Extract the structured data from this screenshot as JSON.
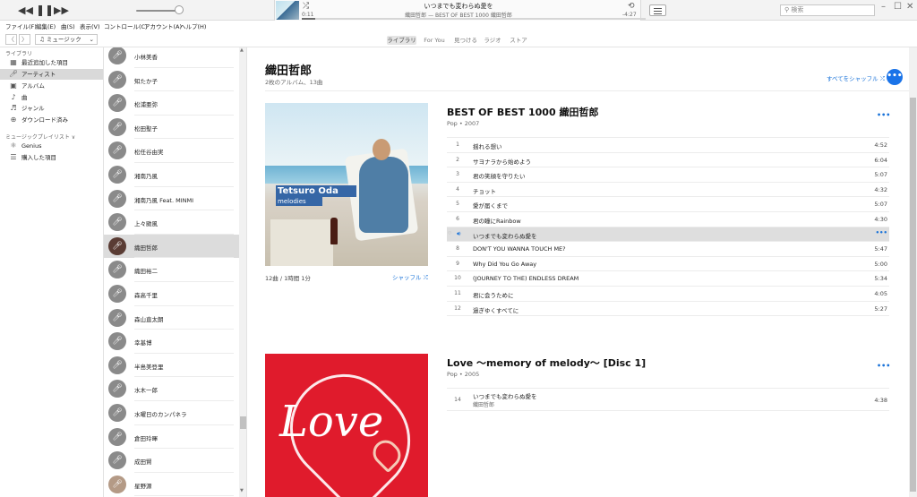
{
  "player": {
    "now_playing_title": "いつまでも変わらぬ愛を",
    "now_playing_sub": "織田哲郎 — BEST OF BEST 1000 織田哲郎",
    "elapsed": "0:11",
    "remaining": "-4:27",
    "progress_fraction": 0.04,
    "volume_fraction": 0.9,
    "search_placeholder": "検索"
  },
  "menu": [
    "ファイル(F)",
    "編集(E)",
    "曲(S)",
    "表示(V)",
    "コントロール(C)",
    "アカウント(A)",
    "ヘルプ(H)"
  ],
  "nav": {
    "media_picker": "ミュージック",
    "tabs": [
      "ライブラリ",
      "For You",
      "見つける",
      "ラジオ",
      "ストア"
    ]
  },
  "sidebar": {
    "library_header": "ライブラリ",
    "library_items": [
      "最近追加した項目",
      "アーティスト",
      "アルバム",
      "曲",
      "ジャンル",
      "ダウンロード済み"
    ],
    "playlists_header": "ミュージックプレイリスト ∨",
    "playlist_items": [
      "Genius",
      "購入した項目"
    ]
  },
  "artists": [
    "小林美香",
    "知たか子",
    "松浦亜弥",
    "松田聖子",
    "松任谷由実",
    "湘南乃風",
    "湘南乃風 Feat. MINMI",
    "上々颱風",
    "織田哲郎",
    "織田裕二",
    "森高千里",
    "森山直太朗",
    "幸基博",
    "半島美登里",
    "水木一郎",
    "水曜日のカンパネラ",
    "倉田玲暉",
    "成田賢",
    "星野源"
  ],
  "selected_artist_index": 8,
  "main": {
    "artist_name": "織田哲郎",
    "artist_summary": "2枚のアルバム、13曲",
    "shuffle_all": "すべてをシャッフル",
    "more_icon": "•••"
  },
  "album1": {
    "title": "BEST OF BEST 1000 織田哲郎",
    "meta": "Pop • 2007",
    "cover_title": "Tetsuro Oda",
    "cover_sub": "melodies",
    "tracks_info": "12曲 / 1時間 1分",
    "shuffle": "シャッフル",
    "tracks": [
      {
        "num": "1",
        "title": "揺れる想い",
        "dur": "4:52"
      },
      {
        "num": "2",
        "title": "サヨナラから始めよう",
        "dur": "6:04"
      },
      {
        "num": "3",
        "title": "君の笑顔を守りたい",
        "dur": "5:07"
      },
      {
        "num": "4",
        "title": "チョット",
        "dur": "4:32"
      },
      {
        "num": "5",
        "title": "愛が届くまで",
        "dur": "5:07"
      },
      {
        "num": "6",
        "title": "君の瞳にRainbow",
        "dur": "4:30"
      },
      {
        "num": "7",
        "title": "いつまでも変わらぬ愛を",
        "dur": "•••"
      },
      {
        "num": "8",
        "title": "DON'T YOU WANNA TOUCH ME?",
        "dur": "5:47"
      },
      {
        "num": "9",
        "title": "Why Did You Go Away",
        "dur": "5:00"
      },
      {
        "num": "10",
        "title": "(JOURNEY TO THE) ENDLESS DREAM",
        "dur": "5:34"
      },
      {
        "num": "11",
        "title": "君に会うために",
        "dur": "4:05"
      },
      {
        "num": "12",
        "title": "過ぎゆくすべてに",
        "dur": "5:27"
      }
    ],
    "playing_index": 6
  },
  "album2": {
    "title": "Love 〜memory of melody〜 [Disc 1]",
    "meta": "Pop • 2005",
    "cover_text": "Love",
    "tracks": [
      {
        "num": "14",
        "title": "いつまでも変わらぬ愛を",
        "artist": "織田哲郎",
        "dur": "4:38"
      }
    ]
  }
}
